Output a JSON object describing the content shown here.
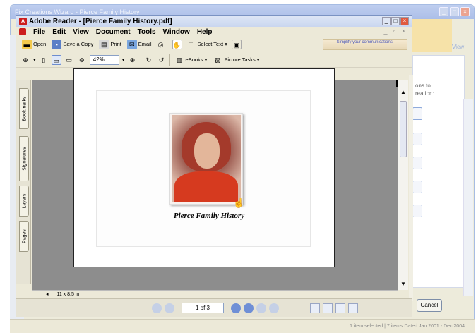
{
  "bg_window": {
    "title": "Fix  Creations Wizard - Pierce Family History",
    "view_label": "View",
    "side_text": [
      "ons to",
      "reation:"
    ],
    "cancel_label": "Cancel",
    "status_text": "1 item selected  |  7 items   Dated Jan 2001 - Dec 2004"
  },
  "reader": {
    "title": "Adobe Reader - [Pierce Family History.pdf]",
    "menu": [
      "File",
      "Edit",
      "View",
      "Document",
      "Tools",
      "Window",
      "Help"
    ],
    "toolbar1": {
      "open": "Open",
      "save_copy": "Save a Copy",
      "print": "Print",
      "email": "Email",
      "select_text": "Select Text",
      "promo": "Simplify your communications!"
    },
    "toolbar2": {
      "zoom": "42%",
      "ebooks": "eBooks",
      "picture_tasks": "Picture Tasks"
    },
    "side_tabs": [
      "Bookmarks",
      "Signatures",
      "Layers",
      "Pages"
    ],
    "doc": {
      "caption": "Pierce Family History"
    },
    "page_size": "11 x 8.5 in",
    "page_indicator": "1 of 3"
  }
}
